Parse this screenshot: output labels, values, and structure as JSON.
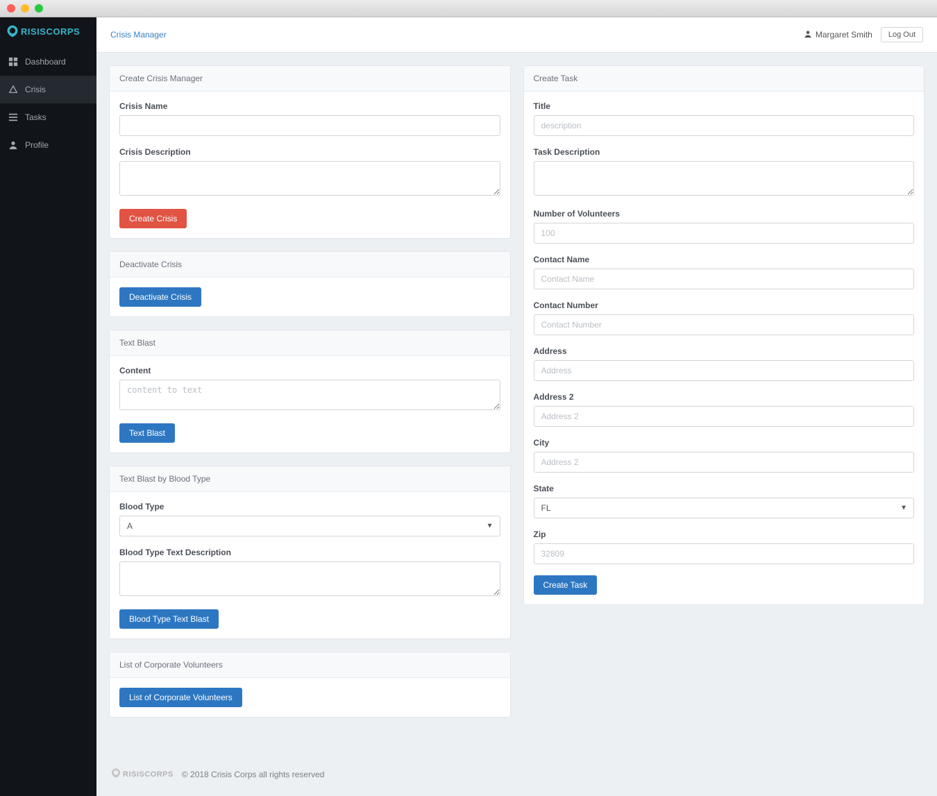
{
  "brand": "RISISCORPS",
  "breadcrumb": "Crisis Manager",
  "user": {
    "name": "Margaret Smith"
  },
  "logout_label": "Log Out",
  "sidebar": {
    "items": [
      {
        "label": "Dashboard"
      },
      {
        "label": "Crisis"
      },
      {
        "label": "Tasks"
      },
      {
        "label": "Profile"
      }
    ]
  },
  "panels": {
    "create_crisis": {
      "title": "Create Crisis Manager",
      "name_label": "Crisis Name",
      "desc_label": "Crisis Description",
      "submit": "Create Crisis"
    },
    "deactivate": {
      "title": "Deactivate Crisis",
      "submit": "Deactivate Crisis"
    },
    "text_blast": {
      "title": "Text Blast",
      "content_label": "Content",
      "content_placeholder": "content to text",
      "submit": "Text Blast"
    },
    "blood_blast": {
      "title": "Text Blast by Blood Type",
      "type_label": "Blood Type",
      "type_value": "A",
      "desc_label": "Blood Type Text Description",
      "submit": "Blood Type Text Blast"
    },
    "corp_vol": {
      "title": "List of Corporate Volunteers",
      "submit": "List of Corporate Volunteers"
    },
    "create_task": {
      "title": "Create Task",
      "title_label": "Title",
      "title_placeholder": "description",
      "desc_label": "Task Description",
      "vol_label": "Number of Volunteers",
      "vol_placeholder": "100",
      "contact_name_label": "Contact Name",
      "contact_name_placeholder": "Contact Name",
      "contact_num_label": "Contact Number",
      "contact_num_placeholder": "Contact Number",
      "addr_label": "Address",
      "addr_placeholder": "Address",
      "addr2_label": "Address 2",
      "addr2_placeholder": "Address 2",
      "city_label": "City",
      "city_placeholder": "Address 2",
      "state_label": "State",
      "state_value": "FL",
      "zip_label": "Zip",
      "zip_placeholder": "32809",
      "submit": "Create Task"
    }
  },
  "footer": {
    "brand": "RISISCORPS",
    "copyright": "© 2018 Crisis Corps all rights reserved"
  }
}
